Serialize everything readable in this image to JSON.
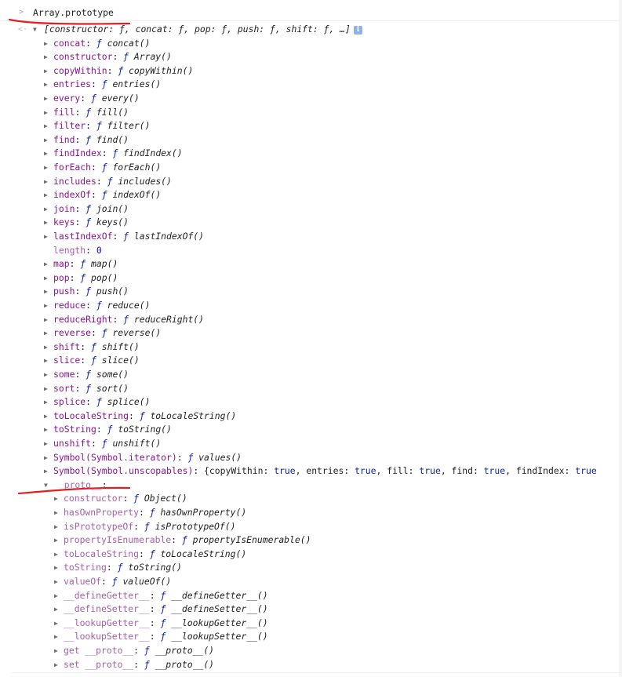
{
  "console": {
    "input": {
      "prompt": ">",
      "text": "Array.prototype"
    },
    "result": {
      "marker": "<·",
      "summary": "[constructor: ƒ, concat: ƒ, pop: ƒ, push: ƒ, shift: ƒ, …]",
      "info_icon": "i"
    },
    "properties": [
      {
        "key": "concat",
        "value": "concat()",
        "kind": "fn"
      },
      {
        "key": "constructor",
        "value": "Array()",
        "kind": "fn"
      },
      {
        "key": "copyWithin",
        "value": "copyWithin()",
        "kind": "fn"
      },
      {
        "key": "entries",
        "value": "entries()",
        "kind": "fn"
      },
      {
        "key": "every",
        "value": "every()",
        "kind": "fn"
      },
      {
        "key": "fill",
        "value": "fill()",
        "kind": "fn"
      },
      {
        "key": "filter",
        "value": "filter()",
        "kind": "fn"
      },
      {
        "key": "find",
        "value": "find()",
        "kind": "fn"
      },
      {
        "key": "findIndex",
        "value": "findIndex()",
        "kind": "fn"
      },
      {
        "key": "forEach",
        "value": "forEach()",
        "kind": "fn"
      },
      {
        "key": "includes",
        "value": "includes()",
        "kind": "fn"
      },
      {
        "key": "indexOf",
        "value": "indexOf()",
        "kind": "fn"
      },
      {
        "key": "join",
        "value": "join()",
        "kind": "fn"
      },
      {
        "key": "keys",
        "value": "keys()",
        "kind": "fn"
      },
      {
        "key": "lastIndexOf",
        "value": "lastIndexOf()",
        "kind": "fn"
      },
      {
        "key": "length",
        "value": "0",
        "kind": "num"
      },
      {
        "key": "map",
        "value": "map()",
        "kind": "fn"
      },
      {
        "key": "pop",
        "value": "pop()",
        "kind": "fn"
      },
      {
        "key": "push",
        "value": "push()",
        "kind": "fn"
      },
      {
        "key": "reduce",
        "value": "reduce()",
        "kind": "fn"
      },
      {
        "key": "reduceRight",
        "value": "reduceRight()",
        "kind": "fn"
      },
      {
        "key": "reverse",
        "value": "reverse()",
        "kind": "fn"
      },
      {
        "key": "shift",
        "value": "shift()",
        "kind": "fn"
      },
      {
        "key": "slice",
        "value": "slice()",
        "kind": "fn"
      },
      {
        "key": "some",
        "value": "some()",
        "kind": "fn"
      },
      {
        "key": "sort",
        "value": "sort()",
        "kind": "fn"
      },
      {
        "key": "splice",
        "value": "splice()",
        "kind": "fn"
      },
      {
        "key": "toLocaleString",
        "value": "toLocaleString()",
        "kind": "fn"
      },
      {
        "key": "toString",
        "value": "toString()",
        "kind": "fn"
      },
      {
        "key": "unshift",
        "value": "unshift()",
        "kind": "fn"
      },
      {
        "key": "Symbol(Symbol.iterator)",
        "value": "values()",
        "kind": "fn"
      },
      {
        "key": "Symbol(Symbol.unscopables)",
        "value": "{copyWithin: true, entries: true, fill: true, find: true, findIndex: true",
        "kind": "obj"
      }
    ],
    "proto": {
      "key": "__proto__",
      "properties": [
        {
          "key": "constructor",
          "value": "Object()"
        },
        {
          "key": "hasOwnProperty",
          "value": "hasOwnProperty()"
        },
        {
          "key": "isPrototypeOf",
          "value": "isPrototypeOf()"
        },
        {
          "key": "propertyIsEnumerable",
          "value": "propertyIsEnumerable()"
        },
        {
          "key": "toLocaleString",
          "value": "toLocaleString()"
        },
        {
          "key": "toString",
          "value": "toString()"
        },
        {
          "key": "valueOf",
          "value": "valueOf()"
        },
        {
          "key": "__defineGetter__",
          "value": "__defineGetter__()"
        },
        {
          "key": "__defineSetter__",
          "value": "__defineSetter__()"
        },
        {
          "key": "__lookupGetter__",
          "value": "__lookupGetter__()"
        },
        {
          "key": "__lookupSetter__",
          "value": "__lookupSetter__()"
        },
        {
          "key": "get __proto__",
          "value": "__proto__()"
        },
        {
          "key": "set __proto__",
          "value": "__proto__()"
        }
      ]
    },
    "glyphs": {
      "collapsed": "▶",
      "expanded": "▼",
      "function": "ƒ",
      "colon": ":"
    }
  },
  "colors": {
    "key": "#881391",
    "dim_key": "#a65fa9",
    "value": "#222222",
    "boolean": "#0d22aa",
    "number": "#1c00cf",
    "annotation": "#e0211f",
    "info_icon": "#8eb1e8"
  }
}
